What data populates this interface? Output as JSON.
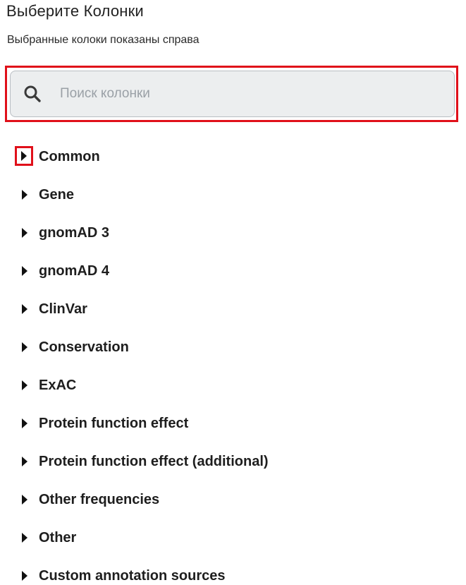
{
  "header": {
    "title": "Выберите Колонки",
    "subtitle": "Выбранные колоки показаны справа"
  },
  "search": {
    "placeholder": "Поиск колонки",
    "value": ""
  },
  "groups": [
    {
      "label": "Common",
      "expanded": false,
      "highlighted": true
    },
    {
      "label": "Gene",
      "expanded": false
    },
    {
      "label": "gnomAD 3",
      "expanded": false
    },
    {
      "label": "gnomAD 4",
      "expanded": false
    },
    {
      "label": "ClinVar",
      "expanded": false
    },
    {
      "label": "Conservation",
      "expanded": false
    },
    {
      "label": "ExAC",
      "expanded": false
    },
    {
      "label": "Protein function effect",
      "expanded": false
    },
    {
      "label": "Protein function effect (additional)",
      "expanded": false
    },
    {
      "label": "Other frequencies",
      "expanded": false
    },
    {
      "label": "Other",
      "expanded": false
    },
    {
      "label": "Custom annotation sources",
      "expanded": false
    }
  ],
  "icons": {
    "search": "search-icon",
    "caret": "caret-right-icon"
  },
  "colors": {
    "highlight": "#e0101a",
    "search_bg": "#eceeef",
    "placeholder": "#9aa0a6"
  }
}
